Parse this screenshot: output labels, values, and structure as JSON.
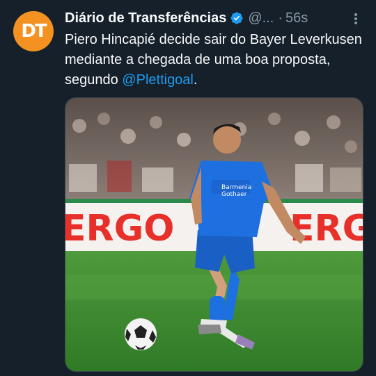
{
  "tweet": {
    "avatar_text": "DT",
    "author_name": "Diário de Transferências",
    "handle": "@...",
    "separator": "·",
    "time": "56s",
    "text_before_mention": "Piero Hincapié decide sair do Bayer Leverkusen mediante a chegada de uma boa proposta, segundo ",
    "mention": "@Plettigoal",
    "text_after_mention": "."
  },
  "photo": {
    "ad_board_text": "ERGO",
    "shirt_sponsor_line1": "Barmenia",
    "shirt_sponsor_line2": "Gothaer"
  },
  "colors": {
    "background": "#15202b",
    "text": "#f7f9f9",
    "secondary": "#8b98a5",
    "link": "#1d9bf0",
    "avatar": "#f39221",
    "jersey": "#1e6fe0",
    "ad_red": "#e8302a"
  },
  "icons": {
    "verified": "verified-badge-icon",
    "more": "more-options-icon"
  }
}
